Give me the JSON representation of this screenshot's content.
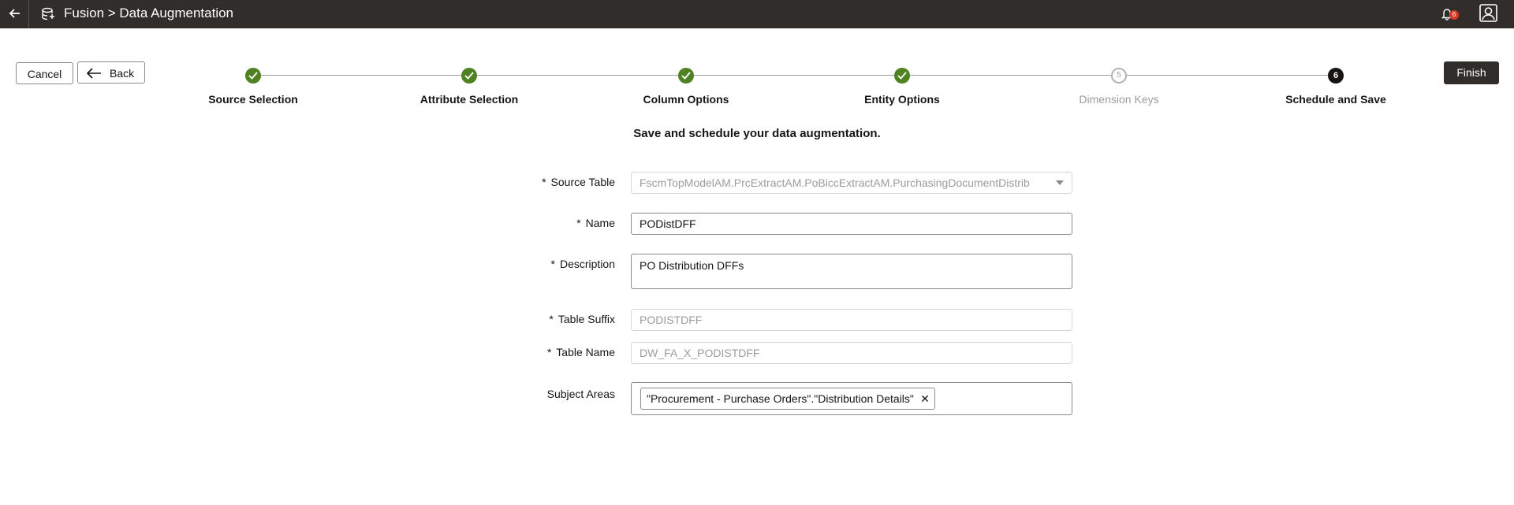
{
  "header": {
    "title": "Fusion > Data Augmentation",
    "notification_count": "6"
  },
  "toolbar": {
    "cancel_label": "Cancel",
    "back_label": "Back",
    "finish_label": "Finish"
  },
  "train": {
    "steps": [
      {
        "label": "Source Selection",
        "status": "complete"
      },
      {
        "label": "Attribute Selection",
        "status": "complete"
      },
      {
        "label": "Column Options",
        "status": "complete"
      },
      {
        "label": "Entity Options",
        "status": "complete"
      },
      {
        "label": "Dimension Keys",
        "status": "pending",
        "number": "5"
      },
      {
        "label": "Schedule and Save",
        "status": "current",
        "number": "6"
      }
    ]
  },
  "instruction": "Save and schedule your data augmentation.",
  "form": {
    "source_table": {
      "label": "Source Table",
      "value": "FscmTopModelAM.PrcExtractAM.PoBiccExtractAM.PurchasingDocumentDistrib"
    },
    "name": {
      "label": "Name",
      "value": "PODistDFF"
    },
    "description": {
      "label": "Description",
      "value": "PO Distribution DFFs"
    },
    "table_suffix": {
      "label": "Table Suffix",
      "value": "PODISTDFF"
    },
    "table_name": {
      "label": "Table Name",
      "value": "DW_FA_X_PODISTDFF"
    },
    "subject_areas": {
      "label": "Subject Areas",
      "chips": [
        "\"Procurement - Purchase Orders\".\"Distribution Details\""
      ]
    }
  },
  "colors": {
    "topbar": "#312d2a",
    "complete": "#508223",
    "current": "#161513",
    "badge": "#d63b25"
  }
}
